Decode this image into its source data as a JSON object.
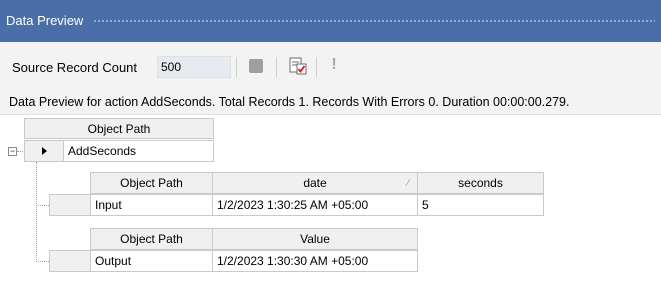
{
  "window": {
    "title": "Data Preview"
  },
  "toolbar": {
    "source_label": "Source Record Count",
    "source_value": "500",
    "stop_icon": "stop-icon",
    "report_icon": "report-check-icon",
    "exclamation_icon": "exclamation-icon",
    "exclamation_glyph": "!"
  },
  "status": "Data Preview for action AddSeconds. Total Records 1. Records With Errors 0. Duration 00:00:00.279.",
  "root_grid": {
    "header": "Object Path",
    "row": {
      "path": "AddSeconds"
    }
  },
  "input_grid": {
    "headers": [
      "Object Path",
      "date",
      "seconds"
    ],
    "row": {
      "path": "Input",
      "date": "1/2/2023 1:30:25 AM +05:00",
      "seconds": "5"
    },
    "sort_glyph": "⁄"
  },
  "output_grid": {
    "headers": [
      "Object Path",
      "Value"
    ],
    "row": {
      "path": "Output",
      "value": "1/2/2023 1:30:30 AM +05:00"
    }
  },
  "colors": {
    "titlebar": "#4a6fa8",
    "toolbar": "#f3f3f3",
    "header": "#f0f0f0"
  }
}
